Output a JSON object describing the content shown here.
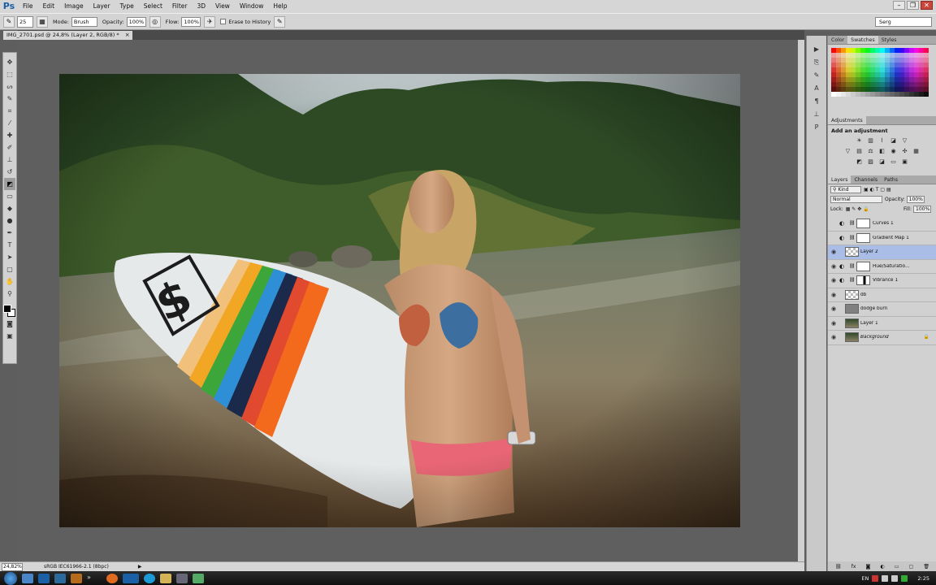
{
  "menubar": {
    "app_logo": "Ps",
    "items": [
      "File",
      "Edit",
      "Image",
      "Layer",
      "Type",
      "Select",
      "Filter",
      "3D",
      "View",
      "Window",
      "Help"
    ]
  },
  "options": {
    "brush_size": "25",
    "mode_label": "Mode:",
    "mode_value": "Brush",
    "opacity_label": "Opacity:",
    "opacity_value": "100%",
    "flow_label": "Flow:",
    "flow_value": "100%",
    "erase_history_label": "Erase to History",
    "workspace": "Serg"
  },
  "document": {
    "tab_title": "IMG_2701.psd @ 24,8% (Layer 2, RGB/8) *"
  },
  "status": {
    "zoom": "24,82%",
    "profile": "sRGB IEC61966-2.1 (8bpc)"
  },
  "panels": {
    "color_tabs": [
      "Color",
      "Swatches",
      "Styles"
    ],
    "adjustments_tab": "Adjustments",
    "adjustments_title": "Add an adjustment",
    "layers_tabs": [
      "Layers",
      "Channels",
      "Paths"
    ],
    "kind_filter": "Kind",
    "blend_mode": "Normal",
    "opacity_label": "Opacity:",
    "opacity_value": "100%",
    "lock_label": "Lock:",
    "fill_label": "Fill:",
    "fill_value": "100%"
  },
  "layers": [
    {
      "name": "Curves 1",
      "visible": false,
      "type": "adjustment",
      "selected": false
    },
    {
      "name": "Gradient Map 1",
      "visible": false,
      "type": "adjustment",
      "selected": false
    },
    {
      "name": "Layer 2",
      "visible": true,
      "type": "pixel-empty",
      "selected": true
    },
    {
      "name": "Hue/Saturatio...",
      "visible": true,
      "type": "adjustment",
      "selected": false
    },
    {
      "name": "Vibrance 1",
      "visible": true,
      "type": "adjustment-masked",
      "selected": false
    },
    {
      "name": "db",
      "visible": true,
      "type": "pixel-empty",
      "selected": false
    },
    {
      "name": "dodge burn",
      "visible": true,
      "type": "gray",
      "selected": false
    },
    {
      "name": "Layer 1",
      "visible": true,
      "type": "photo",
      "selected": false
    },
    {
      "name": "Background",
      "visible": true,
      "type": "photo",
      "selected": false,
      "locked": true
    }
  ],
  "taskbar": {
    "language": "EN",
    "clock": "2:25"
  },
  "colors": {
    "selected_layer": "#a9bde6",
    "panel_bg": "#d1d1d1",
    "canvas_bg": "#5f5f5f"
  }
}
